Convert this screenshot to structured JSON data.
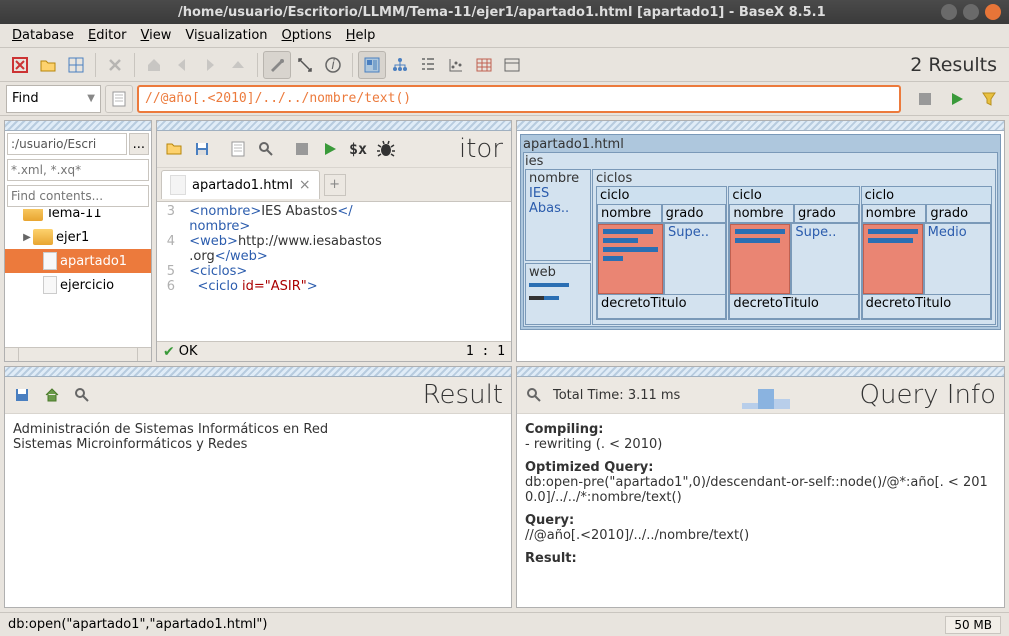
{
  "window": {
    "title": "/home/usuario/Escritorio/LLMM/Tema-11/ejer1/apartado1.html [apartado1] - BaseX 8.5.1"
  },
  "menubar": [
    "Database",
    "Editor",
    "View",
    "Visualization",
    "Options",
    "Help"
  ],
  "toolbar": {
    "results": "2 Results"
  },
  "findbar": {
    "label": "Find",
    "query": "//@año[.<2010]/../../nombre/text()"
  },
  "project": {
    "path": ":/usuario/Escri",
    "filter": "*.xml, *.xq*",
    "find": "Find contents...",
    "tree": [
      {
        "type": "folder",
        "name": "Tema-11",
        "indent": 0,
        "expand": ""
      },
      {
        "type": "folder",
        "name": "ejer1",
        "indent": 1,
        "expand": "▶"
      },
      {
        "type": "file",
        "name": "apartado1",
        "indent": 2,
        "sel": true
      },
      {
        "type": "file",
        "name": "ejercicio",
        "indent": 2,
        "sel": false
      }
    ]
  },
  "editor": {
    "title": "itor",
    "tab": "apartado1.html",
    "lines": [
      {
        "n": 3,
        "html": "  <span class='tag'>&lt;nombre&gt;</span><span class='txt'>IES Abastos</span><span class='tag'>&lt;/</span>"
      },
      {
        "n": "",
        "html": "  <span class='tag'>nombre&gt;</span>"
      },
      {
        "n": 4,
        "html": "  <span class='tag'>&lt;web&gt;</span><span class='txt'>http://www.iesabastos</span>"
      },
      {
        "n": "",
        "html": "  <span class='txt'>.org</span><span class='tag'>&lt;/web&gt;</span>"
      },
      {
        "n": 5,
        "html": "  <span class='tag'>&lt;ciclos&gt;</span>"
      },
      {
        "n": 6,
        "html": "    <span class='tag'>&lt;ciclo</span> <span class='attr'>id=\"ASIR\"</span><span class='tag'>&gt;</span>"
      }
    ],
    "status": "OK",
    "pos": "1 : 1"
  },
  "viz": {
    "file": "apartado1.html",
    "root": "ies",
    "nombre_label": "nombre",
    "nombre_val": "IES Abas..",
    "web_label": "web",
    "ciclos_label": "ciclos",
    "ciclo_label": "ciclo",
    "nombre2": "nombre",
    "grado": "grado",
    "grados": [
      "Supe..",
      "Supe..",
      "Medio"
    ],
    "decreto": "decretoTitulo"
  },
  "result": {
    "title": "Result",
    "lines": [
      "Administración de Sistemas Informáticos en Red",
      "Sistemas Microinformáticos y Redes"
    ]
  },
  "qinfo": {
    "title": "Query Info",
    "total": "Total Time: 3.11 ms",
    "compiling_h": "Compiling:",
    "compiling": "- rewriting (. < 2010)",
    "optq_h": "Optimized Query:",
    "optq": "db:open-pre(\"apartado1\",0)/descendant-or-self::node()/@*:año[. < 2010.0]/../../*:nombre/text()",
    "q_h": "Query:",
    "q": "//@año[.<2010]/../../nombre/text()",
    "res_h": "Result:"
  },
  "appstatus": {
    "cmd": "db:open(\"apartado1\",\"apartado1.html\")",
    "mem": "50 MB"
  }
}
